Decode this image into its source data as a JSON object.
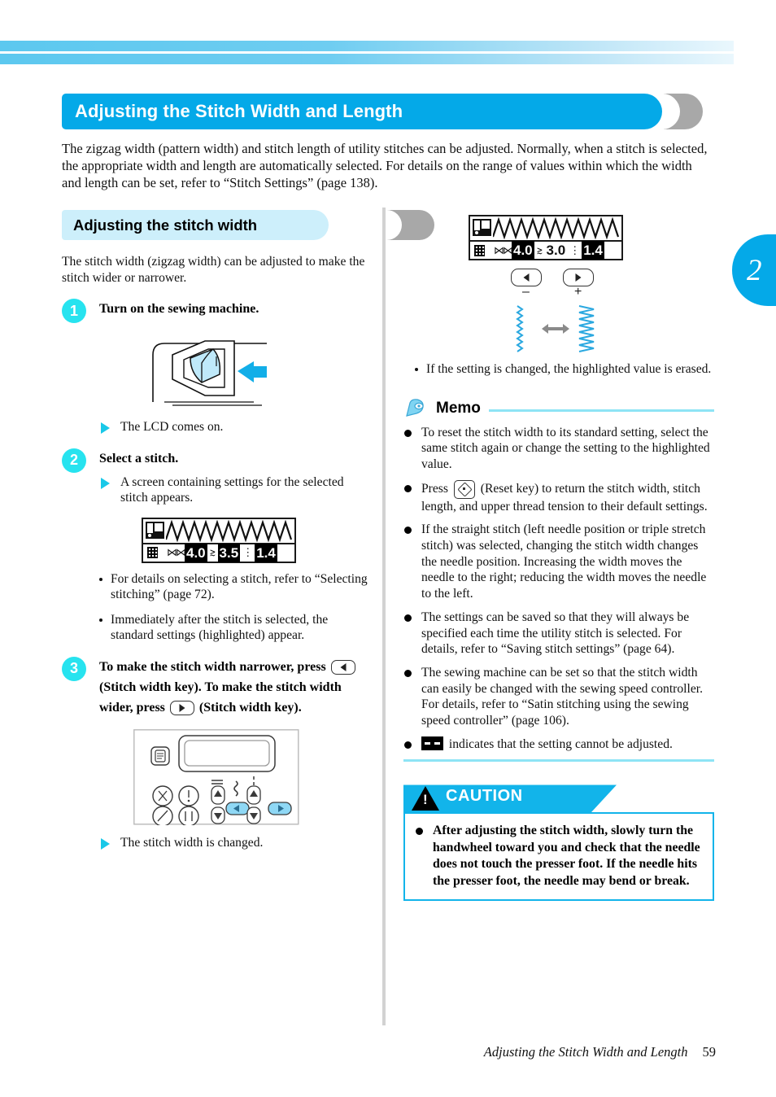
{
  "chapter_tab": "2",
  "section": {
    "title": "Adjusting the Stitch Width and Length",
    "intro": "The zigzag width (pattern width) and stitch length of utility stitches can be adjusted. Normally, when a stitch is selected, the appropriate width and length are automatically selected. For details on the range of values within which the width and length can be set, refer to “Stitch Settings” (page 138)."
  },
  "subsection": {
    "title": "Adjusting the stitch width",
    "intro": "The stitch width (zigzag width) can be adjusted to make the stitch wider or narrower."
  },
  "steps": [
    {
      "number": "1",
      "title": "Turn on the sewing machine.",
      "result": "The LCD comes on."
    },
    {
      "number": "2",
      "title": "Select a stitch.",
      "result": "A screen containing settings for the selected stitch appears.",
      "bullets": [
        "For details on selecting a stitch, refer to “Selecting stitching” (page 72).",
        "Immediately after the stitch is selected, the standard settings (highlighted) appear."
      ]
    },
    {
      "number": "3",
      "title_part1": "To make the stitch width narrower, press",
      "title_part2": "(Stitch width key). To make the stitch width wider, press",
      "title_part3": "(Stitch width key).",
      "result": "The stitch width is changed."
    }
  ],
  "lcd_left": {
    "stitch_width": "4.0",
    "stitch_length": "3.5",
    "thread_tension": "1.4",
    "stitch_width_highlighted": true,
    "stitch_length_highlighted": true,
    "thread_tension_highlighted": true
  },
  "lcd_right": {
    "stitch_width": "4.0",
    "stitch_length": "3.0",
    "thread_tension": "1.4",
    "stitch_width_highlighted": true,
    "stitch_length_highlighted": false,
    "thread_tension_highlighted": true
  },
  "key_compare": {
    "minus_sign": "–",
    "plus_sign": "+"
  },
  "right_note": "If the setting is changed, the highlighted value is erased.",
  "memo": {
    "title": "Memo",
    "items": [
      {
        "text": "To reset the stitch width to its standard setting, select the same stitch again or change the setting to the highlighted value."
      },
      {
        "prefix": "Press",
        "suffix": "(Reset key) to return the stitch width, stitch length, and upper thread tension to their default settings."
      },
      {
        "text": "If the straight stitch (left needle position or triple stretch stitch) was selected, changing the stitch width changes the needle position. Increasing the width moves the needle to the right; reducing the width moves the needle to the left."
      },
      {
        "text": "The settings can be saved so that they will always be specified each time the utility stitch is selected. For details, refer to “Saving stitch settings” (page 64)."
      },
      {
        "text": "The sewing machine can be set so that the stitch width can easily be changed with the sewing speed controller. For details, refer to “Satin stitching using the sewing speed controller” (page 106)."
      },
      {
        "suffix": "indicates that the setting cannot be adjusted."
      }
    ]
  },
  "caution": {
    "label": "CAUTION",
    "items": [
      "After adjusting the stitch width, slowly turn the handwheel toward you and check that the needle does not touch the presser foot. If the needle hits the presser foot, the needle may bend or break."
    ]
  },
  "footer": {
    "title": "Adjusting the Stitch Width and Length",
    "page": "59"
  },
  "colors": {
    "accent": "#04a9e8",
    "light_accent": "#cdeffb",
    "step_badge": "#27e3ef",
    "rule": "#8ee4f5"
  }
}
